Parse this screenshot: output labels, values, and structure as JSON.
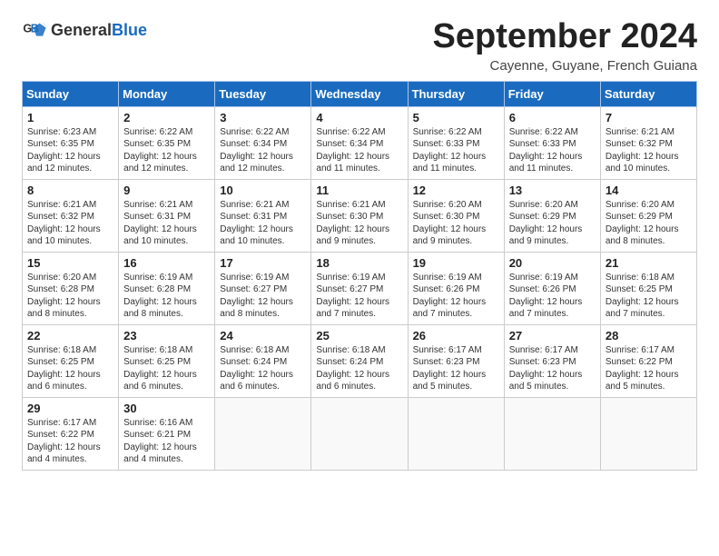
{
  "logo": {
    "text_general": "General",
    "text_blue": "Blue"
  },
  "title": "September 2024",
  "subtitle": "Cayenne, Guyane, French Guiana",
  "header_days": [
    "Sunday",
    "Monday",
    "Tuesday",
    "Wednesday",
    "Thursday",
    "Friday",
    "Saturday"
  ],
  "weeks": [
    [
      {
        "day": "1",
        "sunrise": "6:23 AM",
        "sunset": "6:35 PM",
        "daylight": "12 hours and 12 minutes."
      },
      {
        "day": "2",
        "sunrise": "6:22 AM",
        "sunset": "6:35 PM",
        "daylight": "12 hours and 12 minutes."
      },
      {
        "day": "3",
        "sunrise": "6:22 AM",
        "sunset": "6:34 PM",
        "daylight": "12 hours and 12 minutes."
      },
      {
        "day": "4",
        "sunrise": "6:22 AM",
        "sunset": "6:34 PM",
        "daylight": "12 hours and 11 minutes."
      },
      {
        "day": "5",
        "sunrise": "6:22 AM",
        "sunset": "6:33 PM",
        "daylight": "12 hours and 11 minutes."
      },
      {
        "day": "6",
        "sunrise": "6:22 AM",
        "sunset": "6:33 PM",
        "daylight": "12 hours and 11 minutes."
      },
      {
        "day": "7",
        "sunrise": "6:21 AM",
        "sunset": "6:32 PM",
        "daylight": "12 hours and 10 minutes."
      }
    ],
    [
      {
        "day": "8",
        "sunrise": "6:21 AM",
        "sunset": "6:32 PM",
        "daylight": "12 hours and 10 minutes."
      },
      {
        "day": "9",
        "sunrise": "6:21 AM",
        "sunset": "6:31 PM",
        "daylight": "12 hours and 10 minutes."
      },
      {
        "day": "10",
        "sunrise": "6:21 AM",
        "sunset": "6:31 PM",
        "daylight": "12 hours and 10 minutes."
      },
      {
        "day": "11",
        "sunrise": "6:21 AM",
        "sunset": "6:30 PM",
        "daylight": "12 hours and 9 minutes."
      },
      {
        "day": "12",
        "sunrise": "6:20 AM",
        "sunset": "6:30 PM",
        "daylight": "12 hours and 9 minutes."
      },
      {
        "day": "13",
        "sunrise": "6:20 AM",
        "sunset": "6:29 PM",
        "daylight": "12 hours and 9 minutes."
      },
      {
        "day": "14",
        "sunrise": "6:20 AM",
        "sunset": "6:29 PM",
        "daylight": "12 hours and 8 minutes."
      }
    ],
    [
      {
        "day": "15",
        "sunrise": "6:20 AM",
        "sunset": "6:28 PM",
        "daylight": "12 hours and 8 minutes."
      },
      {
        "day": "16",
        "sunrise": "6:19 AM",
        "sunset": "6:28 PM",
        "daylight": "12 hours and 8 minutes."
      },
      {
        "day": "17",
        "sunrise": "6:19 AM",
        "sunset": "6:27 PM",
        "daylight": "12 hours and 8 minutes."
      },
      {
        "day": "18",
        "sunrise": "6:19 AM",
        "sunset": "6:27 PM",
        "daylight": "12 hours and 7 minutes."
      },
      {
        "day": "19",
        "sunrise": "6:19 AM",
        "sunset": "6:26 PM",
        "daylight": "12 hours and 7 minutes."
      },
      {
        "day": "20",
        "sunrise": "6:19 AM",
        "sunset": "6:26 PM",
        "daylight": "12 hours and 7 minutes."
      },
      {
        "day": "21",
        "sunrise": "6:18 AM",
        "sunset": "6:25 PM",
        "daylight": "12 hours and 7 minutes."
      }
    ],
    [
      {
        "day": "22",
        "sunrise": "6:18 AM",
        "sunset": "6:25 PM",
        "daylight": "12 hours and 6 minutes."
      },
      {
        "day": "23",
        "sunrise": "6:18 AM",
        "sunset": "6:25 PM",
        "daylight": "12 hours and 6 minutes."
      },
      {
        "day": "24",
        "sunrise": "6:18 AM",
        "sunset": "6:24 PM",
        "daylight": "12 hours and 6 minutes."
      },
      {
        "day": "25",
        "sunrise": "6:18 AM",
        "sunset": "6:24 PM",
        "daylight": "12 hours and 6 minutes."
      },
      {
        "day": "26",
        "sunrise": "6:17 AM",
        "sunset": "6:23 PM",
        "daylight": "12 hours and 5 minutes."
      },
      {
        "day": "27",
        "sunrise": "6:17 AM",
        "sunset": "6:23 PM",
        "daylight": "12 hours and 5 minutes."
      },
      {
        "day": "28",
        "sunrise": "6:17 AM",
        "sunset": "6:22 PM",
        "daylight": "12 hours and 5 minutes."
      }
    ],
    [
      {
        "day": "29",
        "sunrise": "6:17 AM",
        "sunset": "6:22 PM",
        "daylight": "12 hours and 4 minutes."
      },
      {
        "day": "30",
        "sunrise": "6:16 AM",
        "sunset": "6:21 PM",
        "daylight": "12 hours and 4 minutes."
      },
      null,
      null,
      null,
      null,
      null
    ]
  ]
}
